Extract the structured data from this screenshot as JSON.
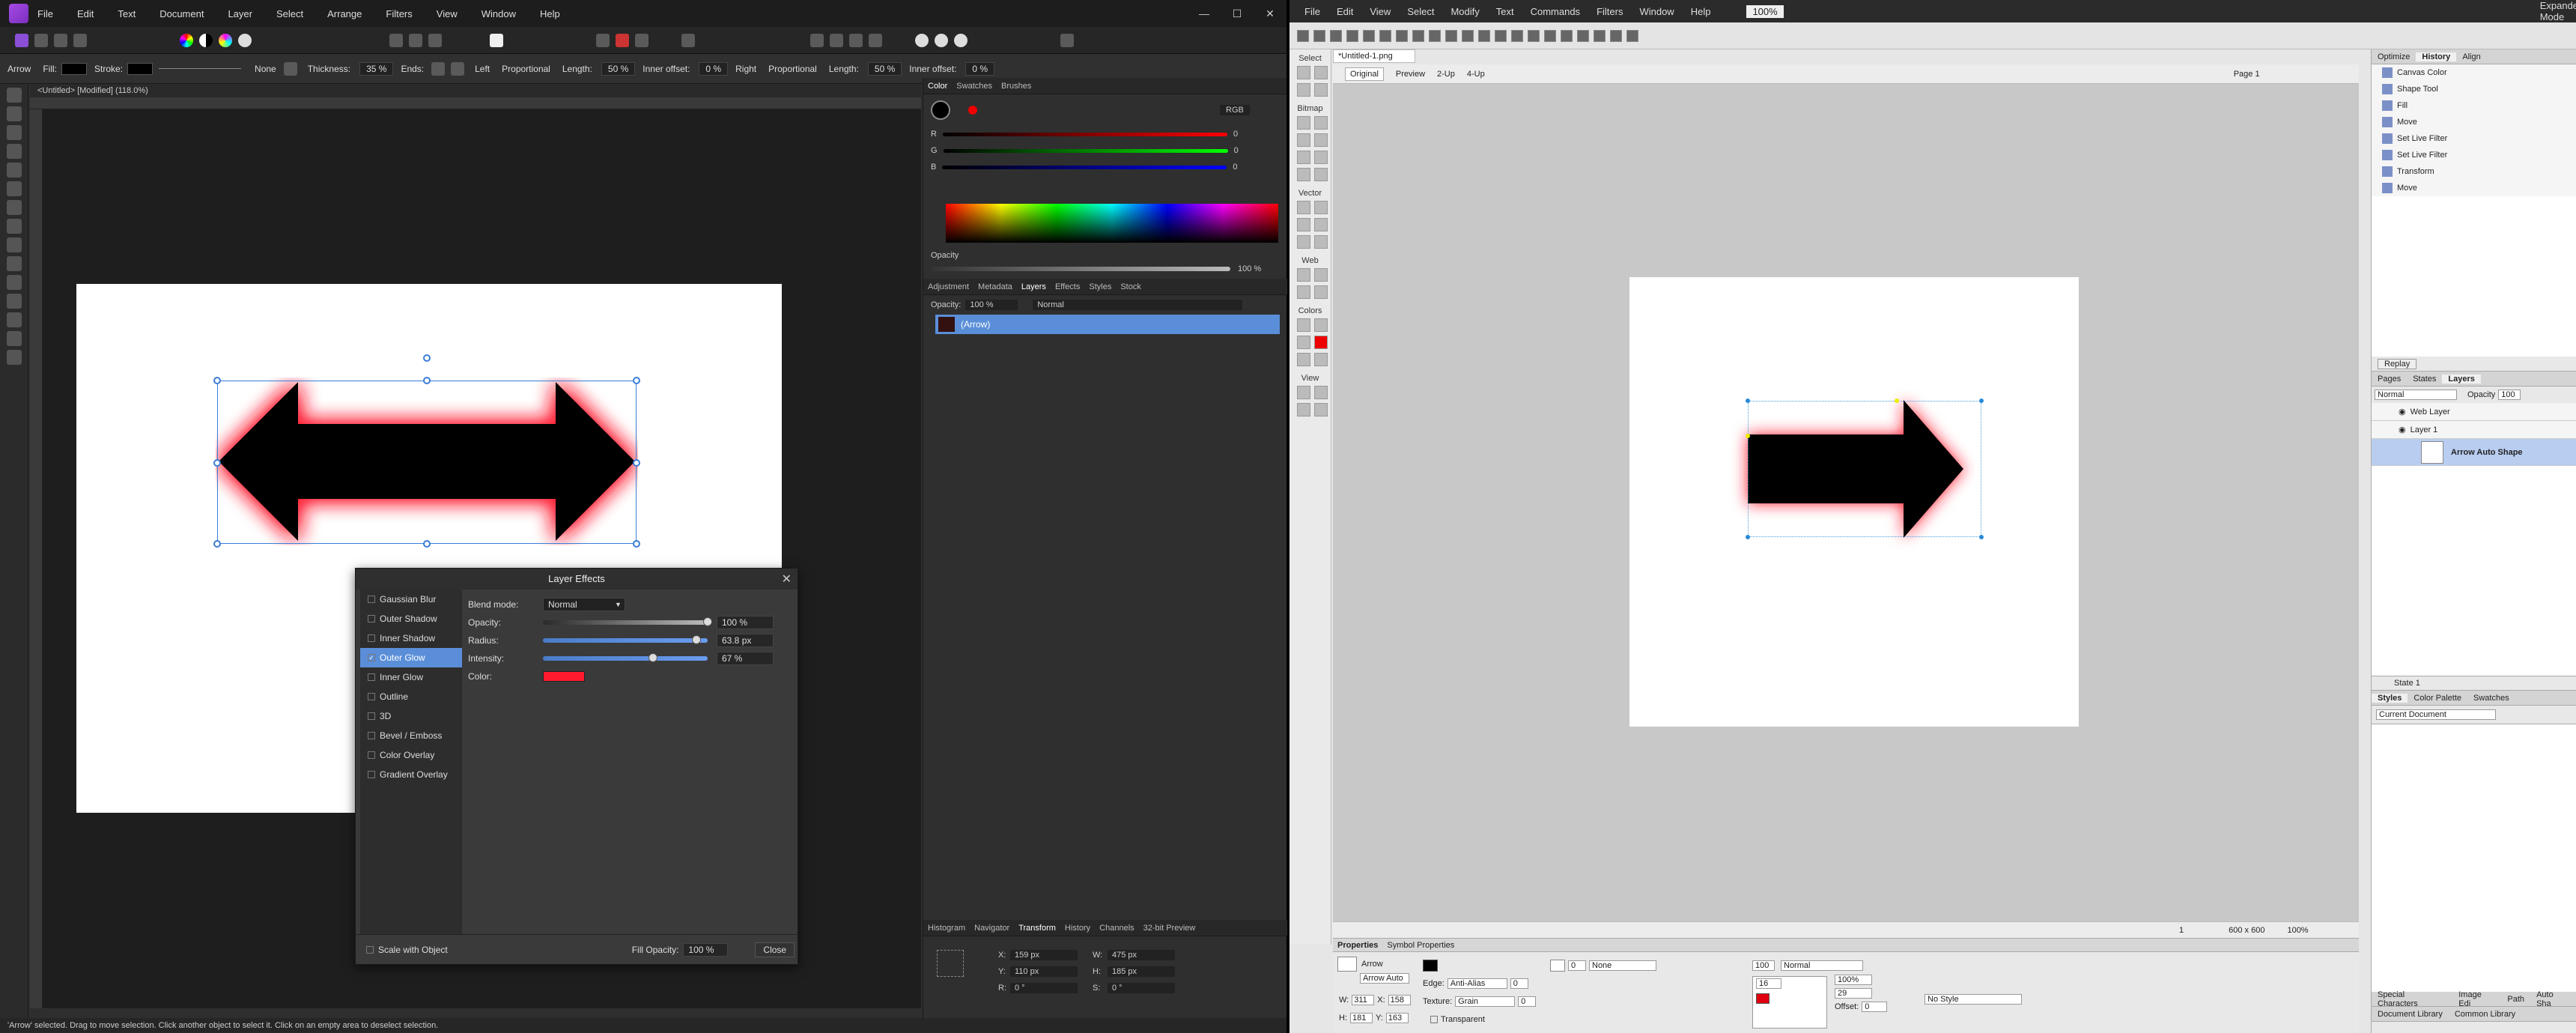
{
  "affinity": {
    "menu": [
      "File",
      "Edit",
      "Text",
      "Document",
      "Layer",
      "Select",
      "Arrange",
      "Filters",
      "View",
      "Window",
      "Help"
    ],
    "context": {
      "tool": "Arrow",
      "fill_label": "Fill:",
      "stroke_label": "Stroke:",
      "stroke_style": "None",
      "thickness_label": "Thickness:",
      "thickness": "35 %",
      "ends_label": "Ends:",
      "left_label": "Left",
      "proportional_left": "Proportional",
      "length_label_left": "Length:",
      "length_left": "50 %",
      "inner_offset_label_left": "Inner offset:",
      "inner_offset_left": "0 %",
      "right_label": "Right",
      "proportional_right": "Proportional",
      "length_label_right": "Length:",
      "length_right": "50 %",
      "inner_offset_label_right": "Inner offset:",
      "inner_offset_right": "0 %"
    },
    "doc_tab": "<Untitled> [Modified] (118.0%)",
    "layer_effects": {
      "title": "Layer Effects",
      "effects": [
        "Gaussian Blur",
        "Outer Shadow",
        "Inner Shadow",
        "Outer Glow",
        "Inner Glow",
        "Outline",
        "3D",
        "Bevel / Emboss",
        "Color Overlay",
        "Gradient Overlay"
      ],
      "selected": "Outer Glow",
      "blend_mode_label": "Blend mode:",
      "blend_mode": "Normal",
      "opacity_label": "Opacity:",
      "opacity": "100 %",
      "opacity_frac": 1.0,
      "radius_label": "Radius:",
      "radius": "63.8 px",
      "radius_frac": 0.93,
      "intensity_label": "Intensity:",
      "intensity": "67 %",
      "intensity_frac": 0.67,
      "color_label": "Color:",
      "glow_color": "#ff1a2e",
      "scale_with_object": "Scale with Object",
      "fill_opacity_label": "Fill Opacity:",
      "fill_opacity": "100 %",
      "close": "Close"
    },
    "color_panel": {
      "tabs": [
        "Color",
        "Swatches",
        "Brushes"
      ],
      "mode": "RGB",
      "r_label": "R",
      "r": "0",
      "g_label": "G",
      "g": "0",
      "b_label": "B",
      "b": "0",
      "opacity_label": "Opacity",
      "opacity": "100 %"
    },
    "layers_panel": {
      "tabs": [
        "Adjustment",
        "Metadata",
        "Layers",
        "Effects",
        "Styles",
        "Stock"
      ],
      "opacity_label": "Opacity:",
      "opacity": "100 %",
      "blend": "Normal",
      "layer_name": "(Arrow)"
    },
    "transform_panel": {
      "tabs": [
        "Histogram",
        "Navigator",
        "Transform",
        "History",
        "Channels",
        "32-bit Preview"
      ],
      "x_label": "X:",
      "x": "159 px",
      "y_label": "Y:",
      "y": "110 px",
      "w_label": "W:",
      "w": "475 px",
      "h_label": "H:",
      "h": "185 px",
      "r_label": "R:",
      "r": "0 °",
      "s_label": "S:",
      "s": "0 °"
    },
    "status": "'Arrow' selected. Drag to move selection. Click another object to select it. Click on an empty area to deselect selection."
  },
  "fireworks": {
    "menu": [
      "File",
      "Edit",
      "View",
      "Select",
      "Modify",
      "Text",
      "Commands",
      "Filters",
      "Window",
      "Help"
    ],
    "zoom": "100%",
    "mode": "Expanded Mode",
    "doc_tab": "*Untitled-1.png",
    "view_tabs": [
      "Original",
      "Preview",
      "2-Up",
      "4-Up"
    ],
    "page": "Page 1",
    "tool_sections": [
      "Select",
      "Bitmap",
      "Vector",
      "Web",
      "Colors",
      "View"
    ],
    "history_tabs": [
      "Optimize",
      "History",
      "Align"
    ],
    "history": [
      "Canvas Color",
      "Shape Tool",
      "Fill",
      "Move",
      "Set Live Filter",
      "Set Live Filter",
      "Transform",
      "Move"
    ],
    "replay": "Replay",
    "layers_tabs": [
      "Pages",
      "States",
      "Layers"
    ],
    "layers_blend": "Normal",
    "layers_opacity_label": "Opacity",
    "layers_opacity": "100",
    "layers": [
      "Web Layer",
      "Layer 1",
      "Arrow Auto Shape"
    ],
    "state": "State 1",
    "styles_tabs": [
      "Styles",
      "Color Palette",
      "Swatches"
    ],
    "styles_select": "Current Document",
    "bottom_bar": "600 x 600",
    "bottom_zoom": "100%",
    "bottom_page": "1",
    "props_tabs": [
      "Properties",
      "Symbol Properties"
    ],
    "props": {
      "name": "Arrow",
      "name2": "Arrow Auto",
      "w_label": "W:",
      "w": "311",
      "x_label": "X:",
      "x": "158",
      "h_label": "H:",
      "h": "181",
      "y_label": "Y:",
      "y": "163",
      "edge_label": "Edge:",
      "edge": "Anti-Alias",
      "edge_val": "0",
      "texture_label": "Texture:",
      "texture": "Grain",
      "texture_val": "0",
      "transparent": "Transparent",
      "stroke_size": "0",
      "stroke_style": "None",
      "opacity": "100",
      "blend": "Normal",
      "size": "16",
      "percent": "100%",
      "angle": "29",
      "offset_label": "Offset:",
      "offset": "0",
      "style": "No Style",
      "fill_color": "#e00010"
    },
    "bottom_tabs": [
      "Special Characters",
      "Image Edi",
      "Path",
      "Auto Sha"
    ],
    "bottom_tabs2": [
      "Document Library",
      "Common Library"
    ]
  }
}
